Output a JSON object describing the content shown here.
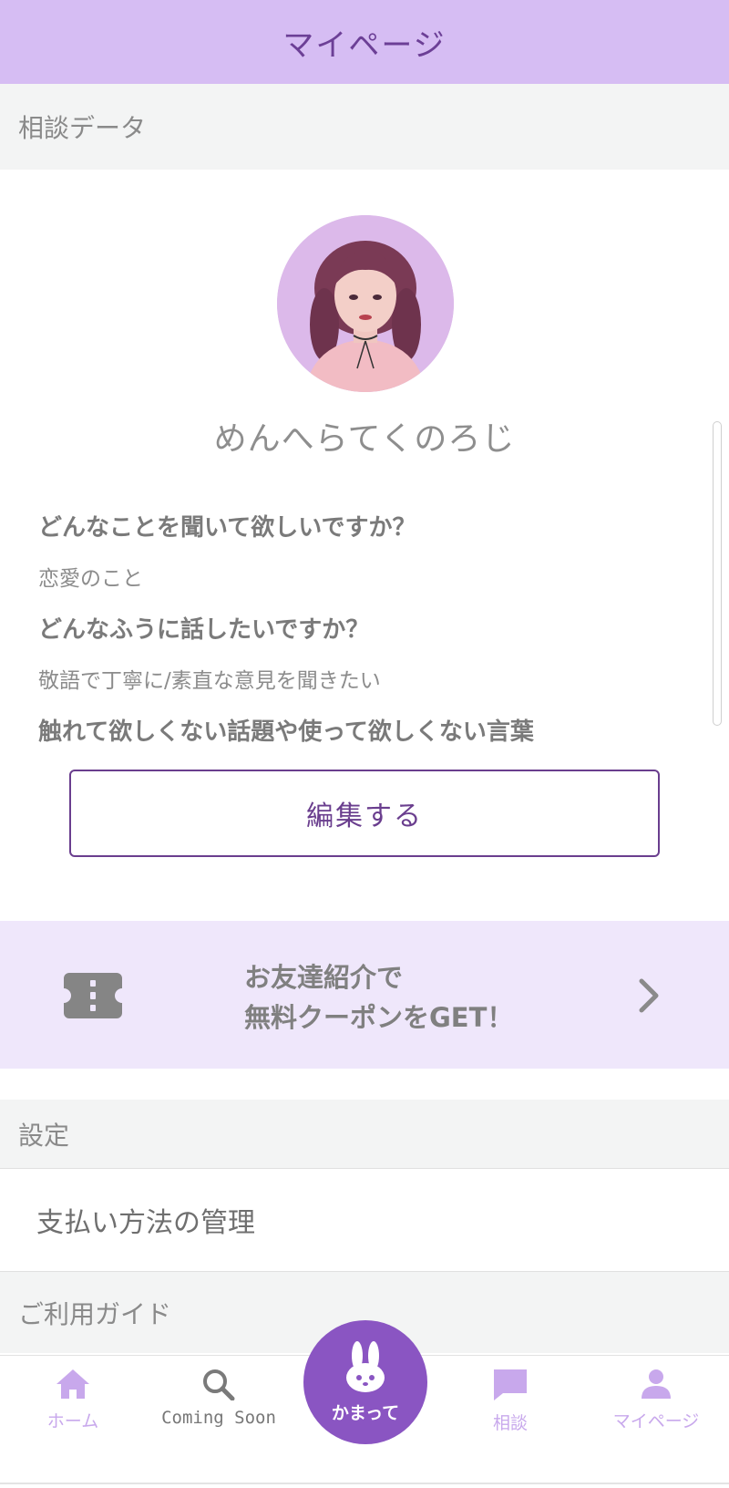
{
  "header": {
    "title": "マイページ"
  },
  "consult_section": {
    "title": "相談データ"
  },
  "profile": {
    "username": "めんへらてくのろじ",
    "qa": [
      {
        "question": "どんなことを聞いて欲しいですか？",
        "answer": "恋愛のこと"
      },
      {
        "question": "どんなふうに話したいですか？",
        "answer": "敬語で丁寧に/素直な意見を聞きたい"
      },
      {
        "question": "触れて欲しくない話題や使って欲しくない言葉",
        "answer": ""
      }
    ],
    "edit_label": "編集する"
  },
  "promo": {
    "line1": "お友達紹介で",
    "line2": "無料クーポンをGET！"
  },
  "settings_section": {
    "title": "設定"
  },
  "payment": {
    "label": "支払い方法の管理"
  },
  "guide_section": {
    "title": "ご利用ガイド"
  },
  "tabbar": {
    "home": "ホーム",
    "search": "Coming Soon",
    "center": "かまって",
    "consult": "相談",
    "mypage": "マイページ"
  },
  "colors": {
    "header_bg": "#d6bdf3",
    "accent": "#8a55c2",
    "promo_bg": "#efe7fb",
    "tab_active": "#c8a8ec"
  }
}
